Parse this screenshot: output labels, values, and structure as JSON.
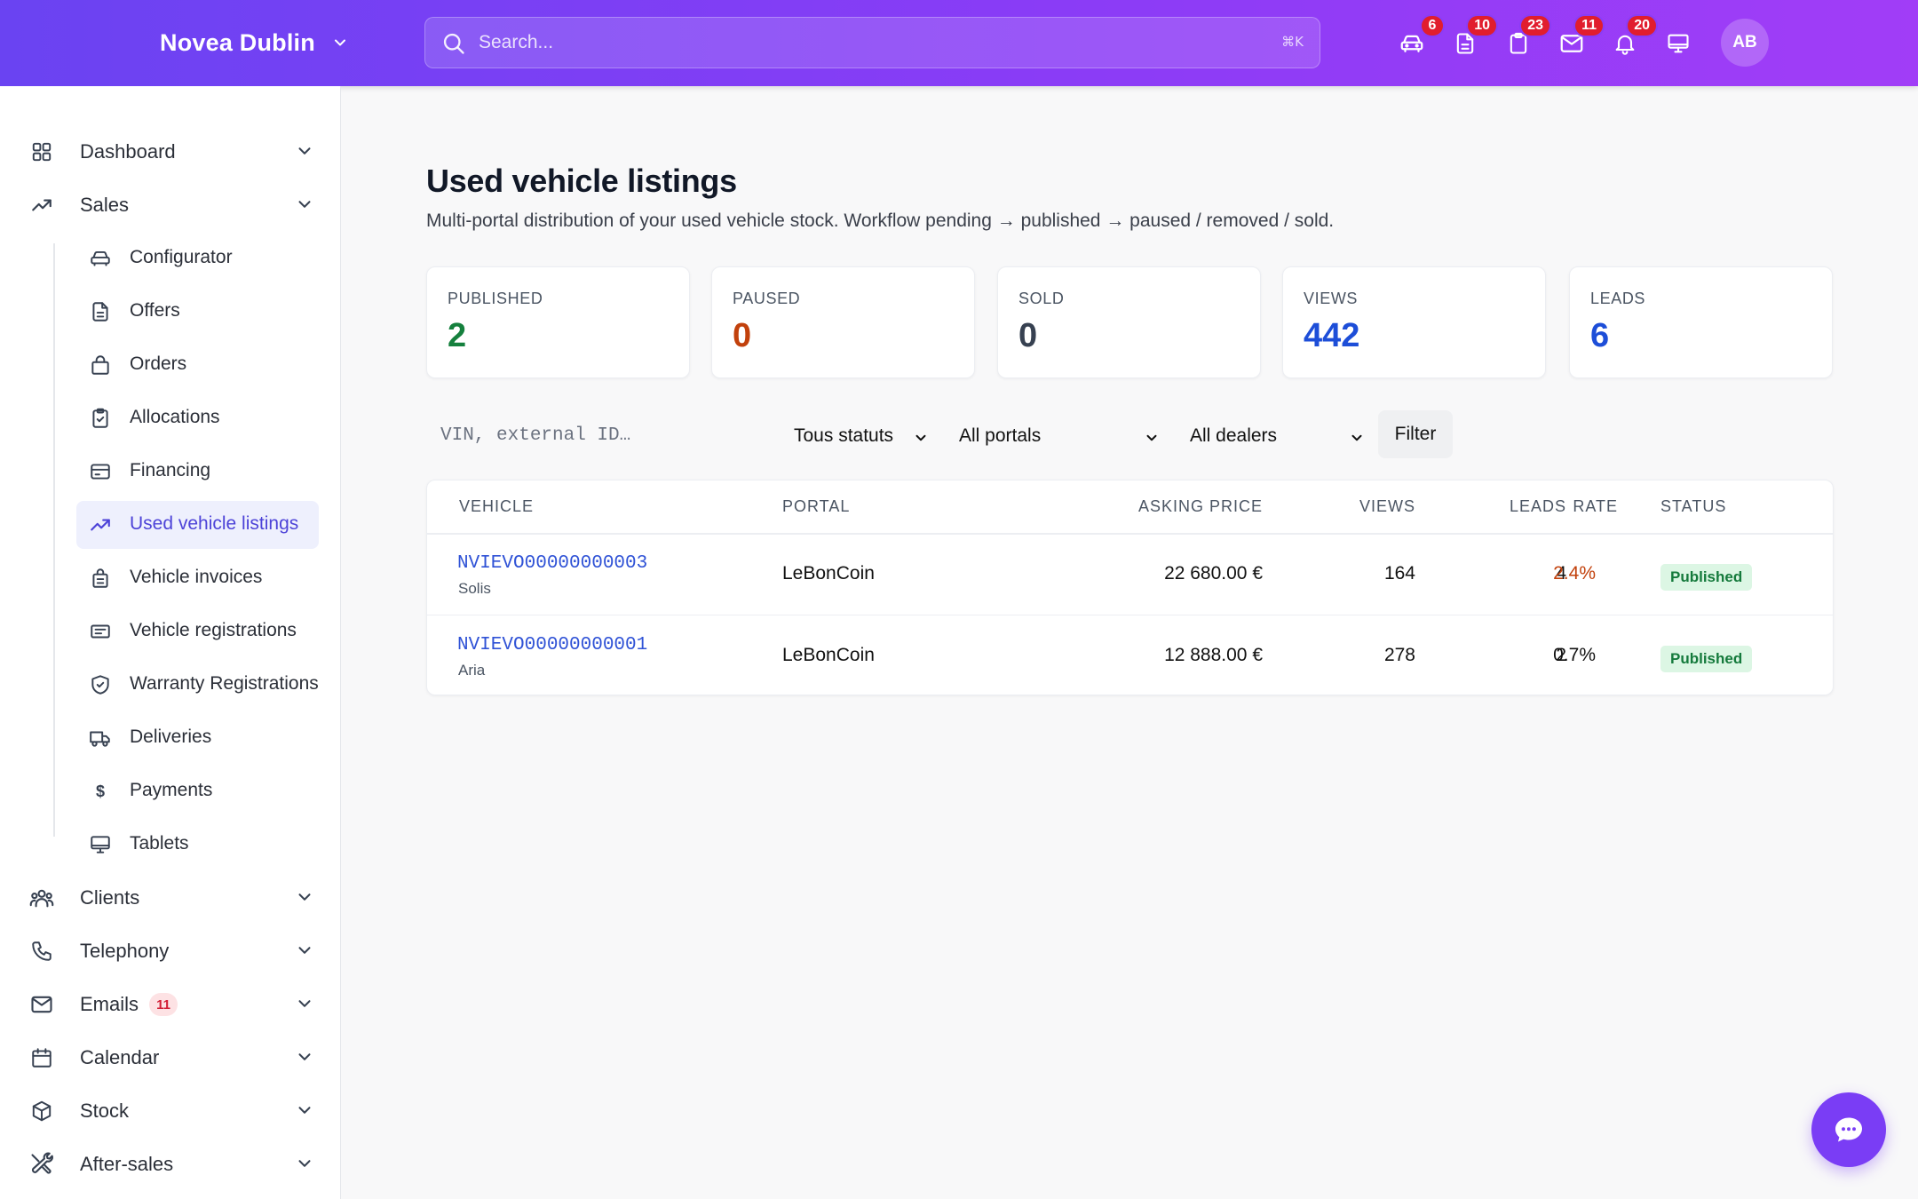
{
  "header": {
    "brand": "Novea Dublin",
    "search_placeholder": "Search...",
    "search_shortcut": "⌘K",
    "icons": [
      {
        "name": "car-icon",
        "badge": "6"
      },
      {
        "name": "document-icon",
        "badge": "10"
      },
      {
        "name": "clipboard-icon",
        "badge": "23"
      },
      {
        "name": "mail-icon",
        "badge": "11"
      },
      {
        "name": "bell-icon",
        "badge": "20"
      },
      {
        "name": "monitor-icon",
        "badge": ""
      }
    ],
    "avatar": "AB"
  },
  "sidebar": {
    "top": [
      {
        "label": "Dashboard",
        "icon": "grid-icon"
      },
      {
        "label": "Sales",
        "icon": "trend-icon"
      },
      {
        "label": "Clients",
        "icon": "users-icon"
      },
      {
        "label": "Telephony",
        "icon": "phone-icon"
      },
      {
        "label": "Emails",
        "icon": "mail-icon",
        "badge": "11"
      },
      {
        "label": "Calendar",
        "icon": "calendar-icon"
      },
      {
        "label": "Stock",
        "icon": "box-icon"
      },
      {
        "label": "After-sales",
        "icon": "tools-icon"
      }
    ],
    "sales_items": [
      {
        "label": "Configurator",
        "icon": "car-icon"
      },
      {
        "label": "Offers",
        "icon": "document-icon"
      },
      {
        "label": "Orders",
        "icon": "bag-icon"
      },
      {
        "label": "Allocations",
        "icon": "clipboard-check-icon"
      },
      {
        "label": "Financing",
        "icon": "card-icon"
      },
      {
        "label": "Used vehicle listings",
        "icon": "trend-icon",
        "active": true
      },
      {
        "label": "Vehicle invoices",
        "icon": "receipt-icon"
      },
      {
        "label": "Vehicle registrations",
        "icon": "id-card-icon"
      },
      {
        "label": "Warranty Registrations",
        "icon": "shield-icon"
      },
      {
        "label": "Deliveries",
        "icon": "truck-icon"
      },
      {
        "label": "Payments",
        "icon": "dollar-icon"
      },
      {
        "label": "Tablets",
        "icon": "monitor-icon"
      }
    ]
  },
  "main": {
    "title": "Used vehicle listings",
    "subtitle": "Multi-portal distribution of your used vehicle stock. Workflow pending → published → paused / removed / sold.",
    "stats": [
      {
        "label": "PUBLISHED",
        "value": "2",
        "color": "#15803d"
      },
      {
        "label": "PAUSED",
        "value": "0",
        "color": "#c2410c"
      },
      {
        "label": "SOLD",
        "value": "0",
        "color": "#374151"
      },
      {
        "label": "VIEWS",
        "value": "442",
        "color": "#1d4ed8"
      },
      {
        "label": "LEADS",
        "value": "6",
        "color": "#1d4ed8"
      }
    ],
    "filters": {
      "search_placeholder": "VIN, external ID…",
      "status": "Tous statuts",
      "portal": "All portals",
      "dealer": "All dealers",
      "button": "Filter"
    },
    "table": {
      "columns": [
        "VEHICLE",
        "PORTAL",
        "ASKING PRICE",
        "VIEWS",
        "LEADS",
        "RATE",
        "STATUS"
      ],
      "rows": [
        {
          "vin": "NVIEVO00000000003",
          "model": "Solis",
          "portal": "LeBonCoin",
          "price": "22 680.00 €",
          "views": "164",
          "leads": "4",
          "rate": "2.4%",
          "rate_color": "#c2410c",
          "status": "Published"
        },
        {
          "vin": "NVIEVO00000000001",
          "model": "Aria",
          "portal": "LeBonCoin",
          "price": "12 888.00 €",
          "views": "278",
          "leads": "2",
          "rate": "0.7%",
          "rate_color": "#111111",
          "status": "Published"
        }
      ]
    }
  },
  "chat_icon": "chat-bubble-icon"
}
